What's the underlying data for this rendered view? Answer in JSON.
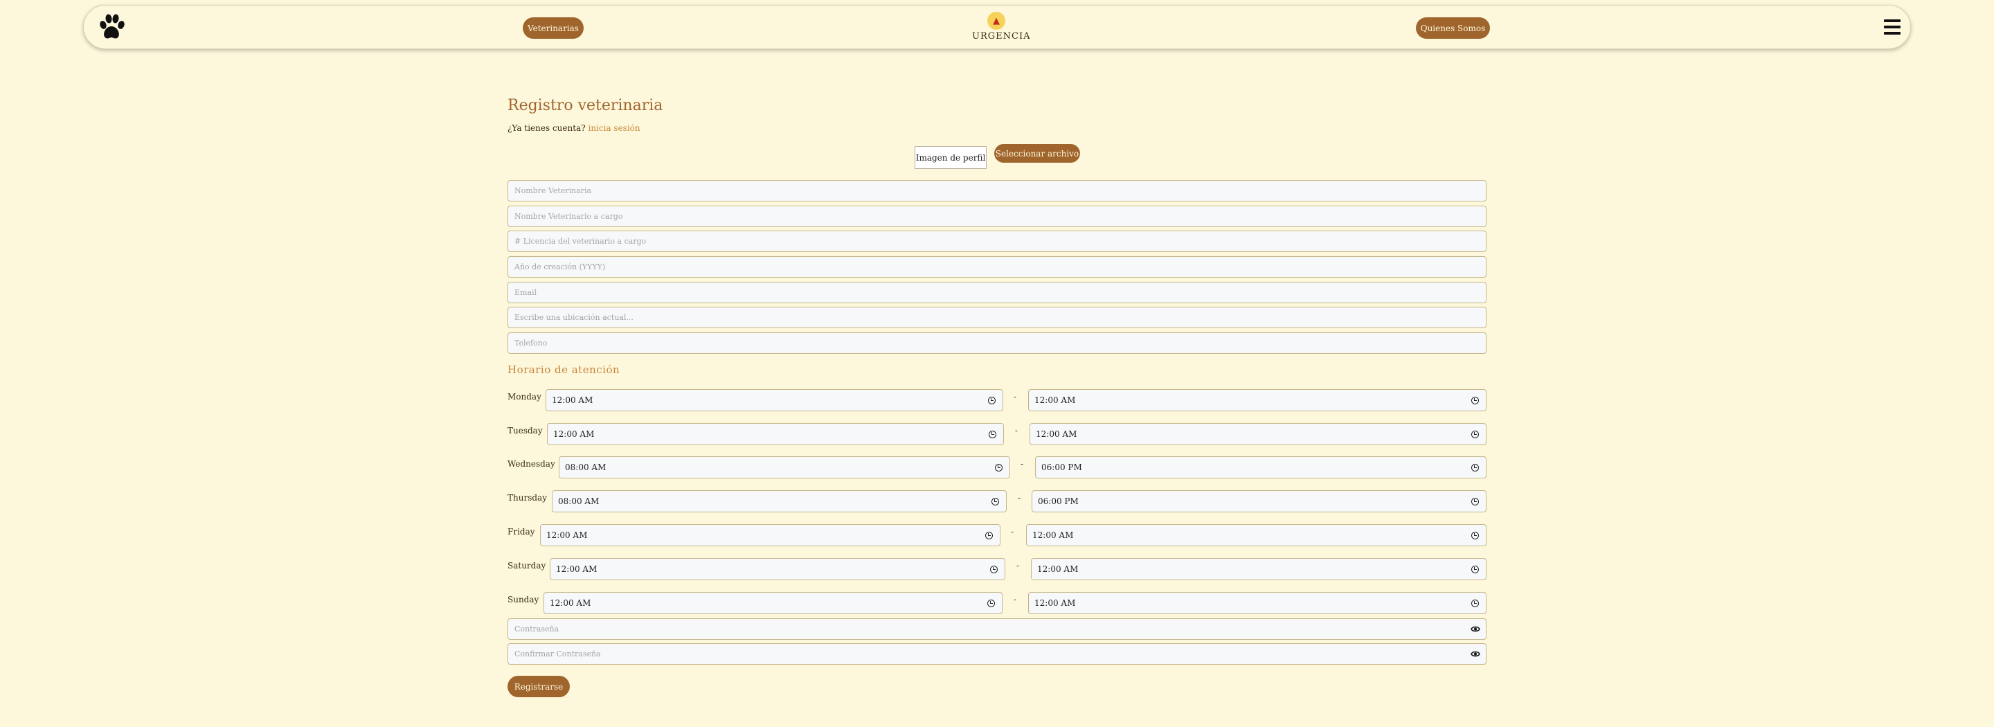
{
  "nav": {
    "vets_label": "Veterinarias",
    "urgency_label": "URGENCIA",
    "about_label": "Quienes Somos",
    "logo_icon": "paw-icon",
    "urgency_icon": "siren-icon",
    "menu_icon": "hamburger-menu-icon"
  },
  "form": {
    "title": "Registro veterinaria",
    "account_prompt": "¿Ya tienes cuenta?",
    "login_link": "inicia sesión",
    "profile_image_label": "Imagen de perfil",
    "select_file_label": "Seleccionar archivo",
    "fields": [
      {
        "placeholder": "Nombre Veterinaria",
        "value": ""
      },
      {
        "placeholder": "Nombre Veterinario a cargo",
        "value": ""
      },
      {
        "placeholder": "# Licencia del veterinario a cargo",
        "value": ""
      },
      {
        "placeholder": "Año de creación (YYYY)",
        "value": ""
      },
      {
        "placeholder": "Email",
        "value": ""
      },
      {
        "placeholder": "Escribe una ubicación actual...",
        "value": ""
      },
      {
        "placeholder": "Telefono",
        "value": ""
      }
    ],
    "schedule_title": "Horario de atención",
    "schedule": [
      {
        "day": "Monday",
        "open": "12:00 AM",
        "close": "12:00 AM"
      },
      {
        "day": "Tuesday",
        "open": "12:00 AM",
        "close": "12:00 AM"
      },
      {
        "day": "Wednesday",
        "open": "08:00 AM",
        "close": "06:00 PM"
      },
      {
        "day": "Thursday",
        "open": "08:00 AM",
        "close": "06:00 PM"
      },
      {
        "day": "Friday",
        "open": "12:00 AM",
        "close": "12:00 AM"
      },
      {
        "day": "Saturday",
        "open": "12:00 AM",
        "close": "12:00 AM"
      },
      {
        "day": "Sunday",
        "open": "12:00 AM",
        "close": "12:00 AM"
      }
    ],
    "separator": "-",
    "password_placeholder": "Contraseña",
    "confirm_password_placeholder": "Confirmar Contraseña",
    "submit_label": "Registrarse"
  },
  "colors": {
    "background": "#fdf8dc",
    "accent": "#a0652d",
    "heading": "#a0652d",
    "link": "#c98a3b"
  }
}
